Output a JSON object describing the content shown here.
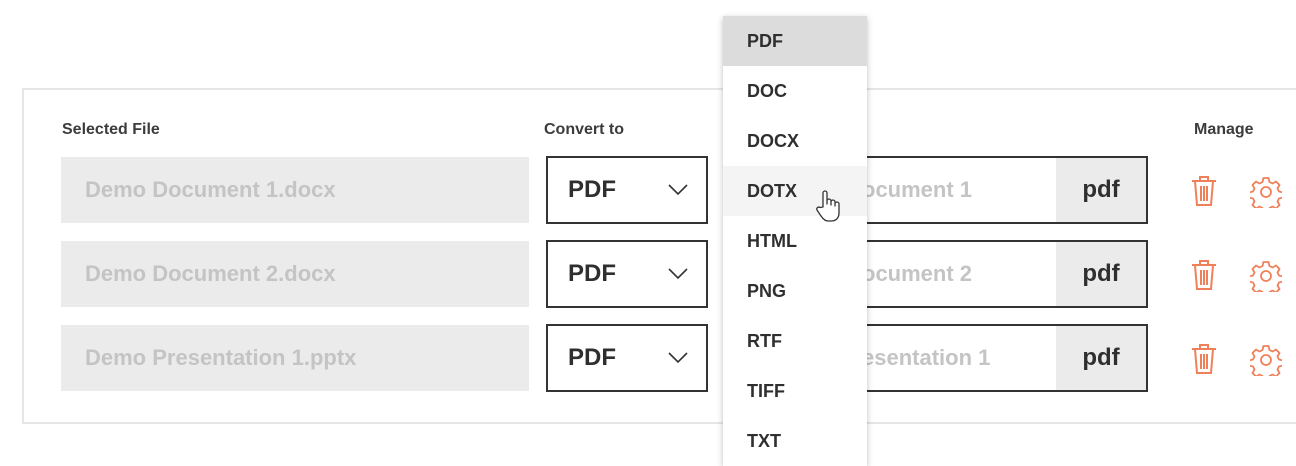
{
  "headers": {
    "selected_file": "Selected File",
    "convert_to": "Convert to",
    "manage": "Manage"
  },
  "rows": [
    {
      "file": "Demo Document 1.docx",
      "format": "PDF",
      "output_name": "ocument 1",
      "extension": "pdf"
    },
    {
      "file": "Demo Document 2.docx",
      "format": "PDF",
      "output_name": "ocument 2",
      "extension": "pdf"
    },
    {
      "file": "Demo Presentation 1.pptx",
      "format": "PDF",
      "output_name": "esentation 1",
      "extension": "pdf"
    }
  ],
  "dropdown": {
    "options": [
      "PDF",
      "DOC",
      "DOCX",
      "DOTX",
      "HTML",
      "PNG",
      "RTF",
      "TIFF",
      "TXT"
    ],
    "selected": "PDF",
    "hovered": "DOTX"
  },
  "colors": {
    "action_icon": "#f0805a",
    "selected_option_bg": "#dcdcdc"
  },
  "icons": {
    "delete": "trash-icon",
    "settings": "gear-icon",
    "select": "chevron-down-icon",
    "pointer": "hand-cursor-icon"
  }
}
